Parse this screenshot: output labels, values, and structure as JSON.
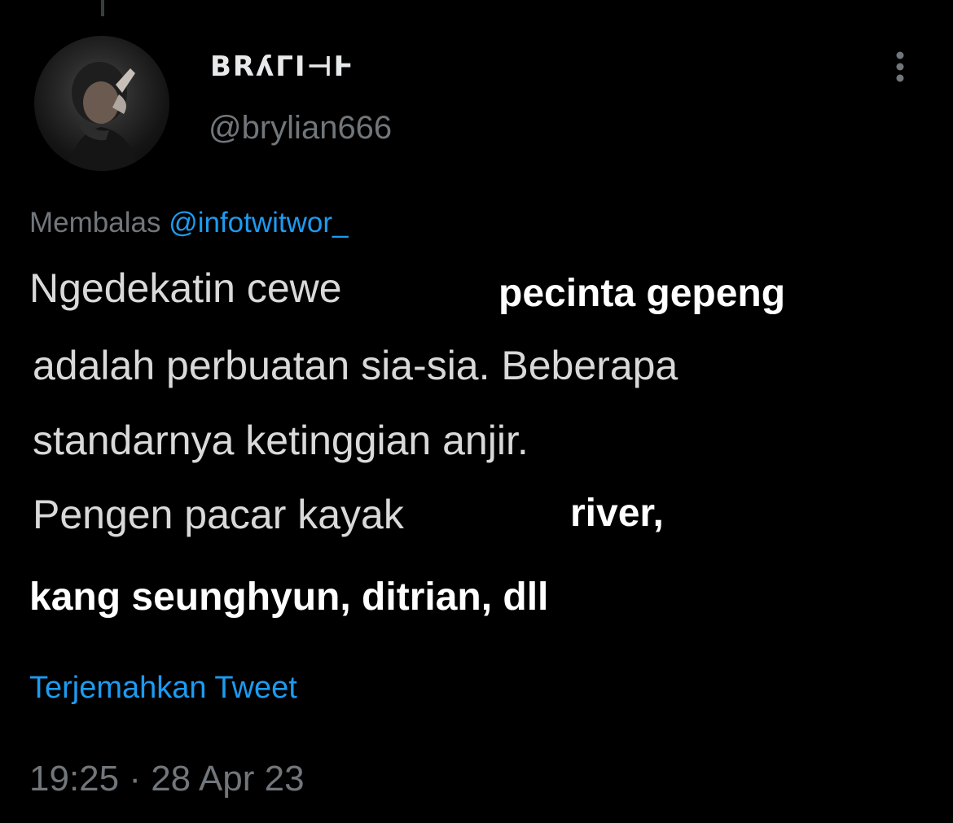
{
  "tweet": {
    "display_name": "BRʎΓΙ⊣Ͱ",
    "handle": "@brylian666",
    "reply_prefix": "Membalas",
    "reply_mention": "@infotwitwor_",
    "text_lines": [
      "Ngedekatin cewe",
      "adalah perbuatan sia-sia. Beberapa",
      "standarnya ketinggian anjir.",
      "Pengen pacar kayak"
    ],
    "overlay_edits": [
      "pecinta gepeng",
      "river,",
      "kang seunghyun, ditrian, dll"
    ],
    "translate_label": "Terjemahkan Tweet",
    "timestamp": "19:25 · 28 Apr 23"
  },
  "icons": {
    "more": "more-vertical-icon",
    "avatar": "profile-avatar"
  },
  "colors": {
    "background": "#000000",
    "link": "#1d9bf0",
    "muted": "#71767b",
    "text": "#d9d9d9"
  }
}
